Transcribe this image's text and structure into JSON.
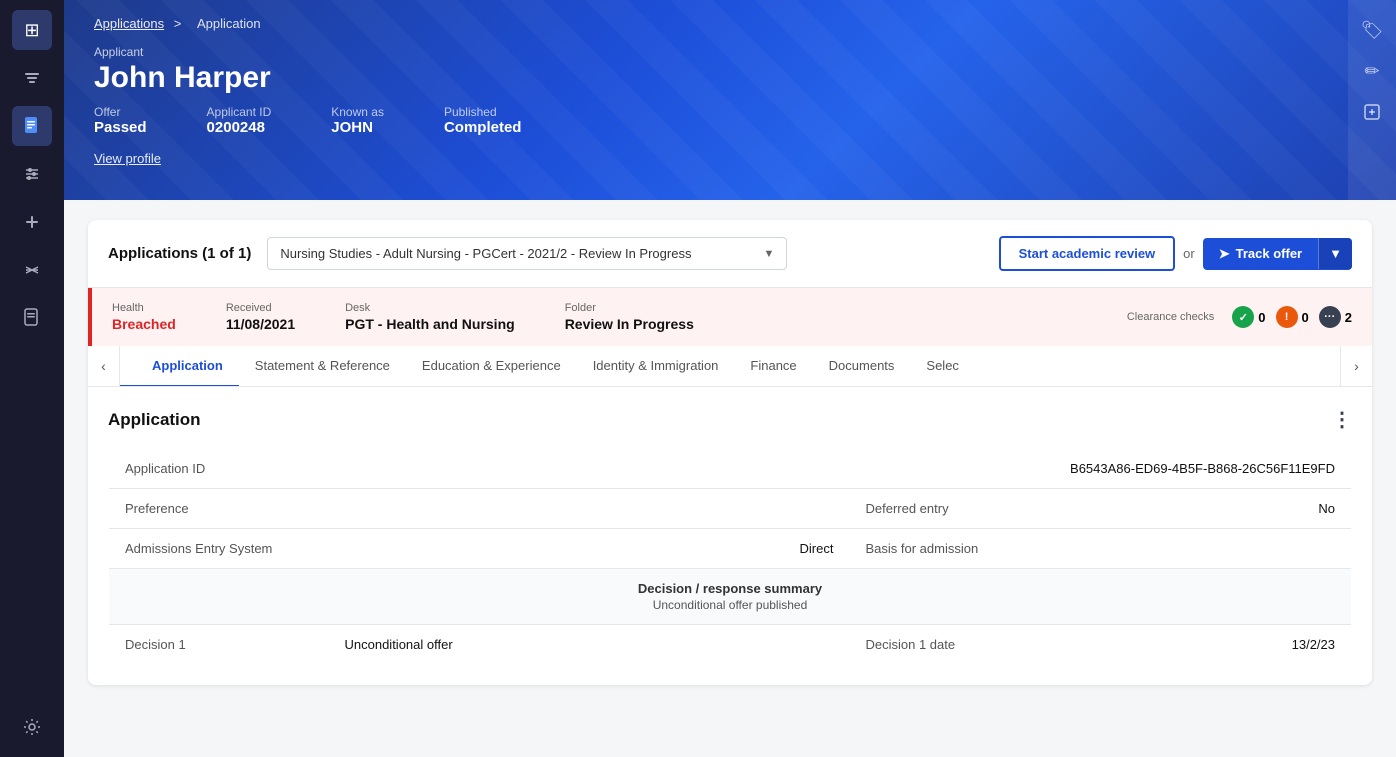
{
  "sidebar": {
    "icons": [
      {
        "name": "grid-icon",
        "symbol": "⊞",
        "active": true
      },
      {
        "name": "filter-icon",
        "symbol": "⊟",
        "active": false
      },
      {
        "name": "document-icon",
        "symbol": "📄",
        "active": true
      },
      {
        "name": "sliders-icon",
        "symbol": "⚙",
        "active": false
      },
      {
        "name": "plus-icon",
        "symbol": "+",
        "active": false
      },
      {
        "name": "merge-icon",
        "symbol": "⇄",
        "active": false
      },
      {
        "name": "doc2-icon",
        "symbol": "📋",
        "active": false
      }
    ],
    "bottom_icon": {
      "name": "settings-icon",
      "symbol": "⚙"
    }
  },
  "breadcrumb": {
    "link": "Applications",
    "separator": ">",
    "current": "Application"
  },
  "applicant": {
    "label": "Applicant",
    "name": "John Harper",
    "view_profile": "View profile"
  },
  "meta": {
    "offer_label": "Offer",
    "offer_value": "Passed",
    "applicant_id_label": "Applicant ID",
    "applicant_id_value": "0200248",
    "known_as_label": "Known as",
    "known_as_value": "JOHN",
    "published_label": "Published",
    "published_value": "Completed"
  },
  "applications_section": {
    "title": "Applications (1 of 1)",
    "selector_text": "Nursing Studies - Adult Nursing - PGCert - 2021/2 - Review In Progress",
    "btn_academic": "Start academic review",
    "or_text": "or",
    "btn_track": "Track offer",
    "btn_track_icon": "➤"
  },
  "status": {
    "health_label": "Health",
    "health_value": "Breached",
    "received_label": "Received",
    "received_value": "11/08/2021",
    "desk_label": "Desk",
    "desk_value": "PGT - Health and Nursing",
    "folder_label": "Folder",
    "folder_value": "Review In Progress",
    "clearance_label": "Clearance checks",
    "check1_count": "0",
    "check2_count": "0",
    "check3_count": "2"
  },
  "tabs": [
    {
      "label": "Application",
      "active": true
    },
    {
      "label": "Statement & Reference",
      "active": false
    },
    {
      "label": "Education & Experience",
      "active": false
    },
    {
      "label": "Identity & Immigration",
      "active": false
    },
    {
      "label": "Finance",
      "active": false
    },
    {
      "label": "Documents",
      "active": false
    },
    {
      "label": "Selec",
      "active": false
    }
  ],
  "application_section": {
    "title": "Application",
    "menu_icon": "⋮",
    "fields": {
      "app_id_label": "Application ID",
      "app_id_value": "B6543A86-ED69-4B5F-B868-26C56F11E9FD",
      "preference_label": "Preference",
      "deferred_entry_label": "Deferred entry",
      "deferred_entry_value": "No",
      "admissions_label": "Admissions Entry System",
      "admissions_value": "Direct",
      "basis_label": "Basis for admission",
      "basis_value": "",
      "decision_summary_header": "Decision / response summary",
      "decision_summary_sub": "Unconditional offer published",
      "decision1_label": "Decision 1",
      "decision1_value": "Unconditional offer",
      "decision1_date_label": "Decision 1 date",
      "decision1_date_value": "13/2/23"
    }
  }
}
